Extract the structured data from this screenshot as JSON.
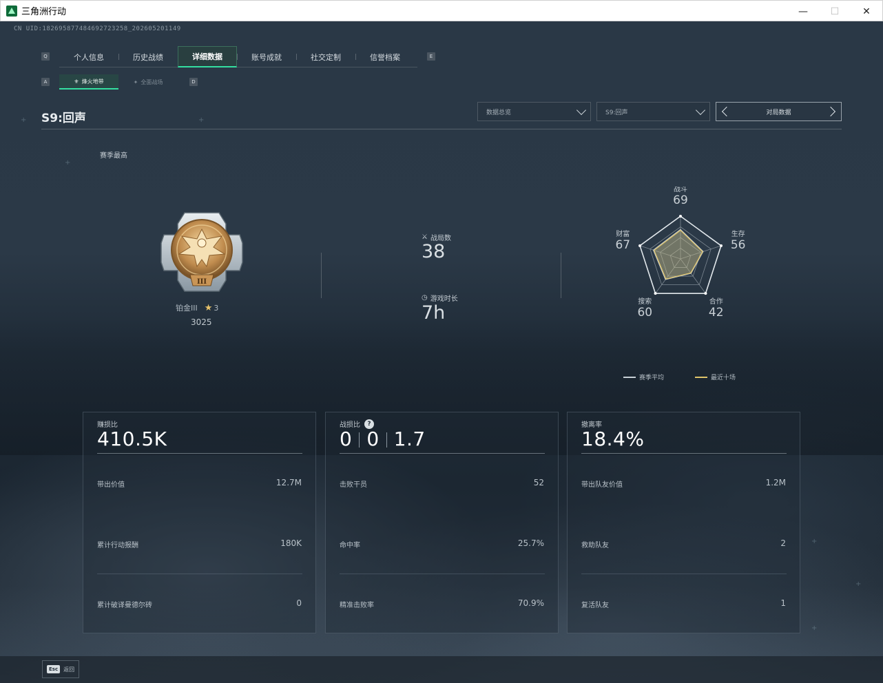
{
  "window": {
    "title": "三角洲行动",
    "minimize_icon": "minimize-icon",
    "maximize_icon": "maximize-icon",
    "close_icon": "close-icon"
  },
  "uid": "CN UID:182695877484692723258_202605201149",
  "main_tabs": {
    "left_key": "Q",
    "right_key": "E",
    "items": [
      {
        "label": "个人信息",
        "active": false
      },
      {
        "label": "历史战绩",
        "active": false
      },
      {
        "label": "详细数据",
        "active": true
      },
      {
        "label": "账号成就",
        "active": false
      },
      {
        "label": "社交定制",
        "active": false
      },
      {
        "label": "信誉档案",
        "active": false
      }
    ]
  },
  "sub_tabs": {
    "left_key": "A",
    "right_key": "D",
    "items": [
      {
        "label": "烽火地带",
        "active": true,
        "icon": "fire-zone-icon"
      },
      {
        "label": "全面战场",
        "active": false,
        "icon": "battlefield-icon"
      }
    ]
  },
  "header": {
    "season_title": "S9:回声",
    "dropdown_view": "数据总览",
    "dropdown_season": "S9:回声",
    "pager_label": "对局数据"
  },
  "rank": {
    "section_label": "赛季最高",
    "tier": "铂金III",
    "stars": "3",
    "score": "3025"
  },
  "summary": {
    "matches_label": "战局数",
    "matches_value": "38",
    "playtime_label": "游戏时长",
    "playtime_value": "7h"
  },
  "radar": {
    "axes": [
      {
        "label": "战斗",
        "value": "69"
      },
      {
        "label": "生存",
        "value": "56"
      },
      {
        "label": "合作",
        "value": "42"
      },
      {
        "label": "搜索",
        "value": "60"
      },
      {
        "label": "财富",
        "value": "67"
      }
    ],
    "legend_season": "赛季平均",
    "legend_recent": "最近十场",
    "season_color": "#c8d0d6",
    "recent_color": "#e0c56a"
  },
  "panels": [
    {
      "label": "赚损比",
      "value": "410.5K",
      "rows": [
        {
          "label": "带出价值",
          "value": "12.7M"
        },
        {
          "label": "累计行动报酬",
          "value": "180K"
        },
        {
          "label": "累计破译曼德尔砖",
          "value": "0"
        }
      ]
    },
    {
      "label": "战损比",
      "kd_values": [
        "0",
        "0",
        "1.7"
      ],
      "rows": [
        {
          "label": "击败干员",
          "value": "52"
        },
        {
          "label": "命中率",
          "value": "25.7%"
        },
        {
          "label": "精准击败率",
          "value": "70.9%"
        }
      ]
    },
    {
      "label": "撤离率",
      "value": "18.4%",
      "rows": [
        {
          "label": "带出队友价值",
          "value": "1.2M"
        },
        {
          "label": "救助队友",
          "value": "2"
        },
        {
          "label": "复活队友",
          "value": "1"
        }
      ]
    }
  ],
  "footer": {
    "esc_key": "Esc",
    "esc_label": "返回"
  }
}
